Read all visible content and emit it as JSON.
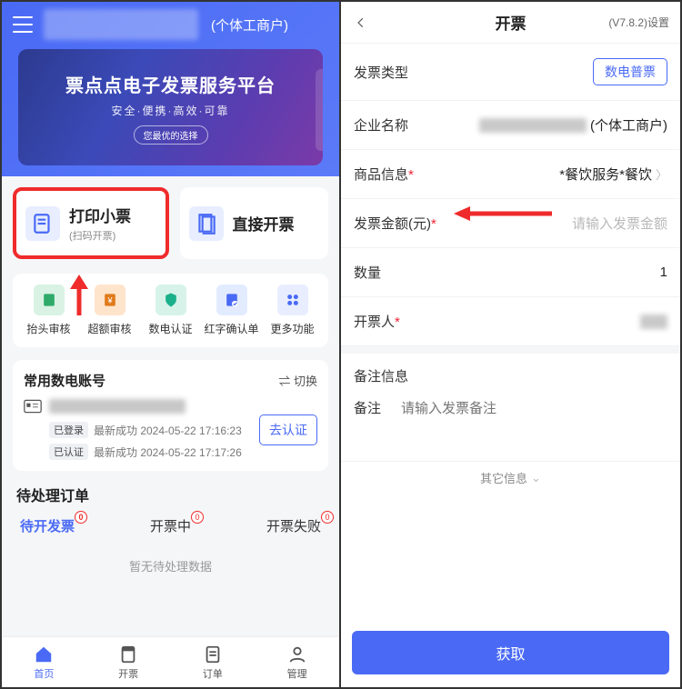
{
  "left": {
    "merchant_suffix": "(个体工商户)",
    "banner": {
      "title": "票点点电子发票服务平台",
      "subtitle": "安全·便携·高效·可靠",
      "chip": "您最优的选择"
    },
    "cards": {
      "print": {
        "title": "打印小票",
        "sub": "(扫码开票)"
      },
      "direct": {
        "title": "直接开票"
      }
    },
    "grid": [
      "抬头审核",
      "超额审核",
      "数电认证",
      "红字确认单",
      "更多功能"
    ],
    "account": {
      "section_title": "常用数电账号",
      "switch": "⇌ 切换",
      "logged_tag": "已登录",
      "verified_tag": "已认证",
      "line1": "最新成功 2024-05-22 17:16:23",
      "line2": "最新成功 2024-05-22 17:17:26",
      "verify_btn": "去认证"
    },
    "orders": {
      "title": "待处理订单",
      "tabs": [
        "待开发票",
        "开票中",
        "开票失败"
      ],
      "badges": [
        "0",
        "0",
        "0"
      ],
      "empty": "暂无待处理数据"
    },
    "tabbar": [
      "首页",
      "开票",
      "订单",
      "管理"
    ]
  },
  "right": {
    "nav_title": "开票",
    "nav_right": "(V7.8.2)设置",
    "rows": {
      "type_label": "发票类型",
      "type_value": "数电普票",
      "company_label": "企业名称",
      "company_suffix": "(个体工商户)",
      "product_label": "商品信息",
      "product_value": "*餐饮服务*餐饮",
      "amount_label": "发票金额(元)",
      "amount_placeholder": "请输入发票金额",
      "qty_label": "数量",
      "qty_value": "1",
      "drawer_label": "开票人"
    },
    "remark": {
      "head": "备注信息",
      "label": "备注",
      "placeholder": "请输入发票备注"
    },
    "other_info": "其它信息",
    "submit": "获取"
  }
}
